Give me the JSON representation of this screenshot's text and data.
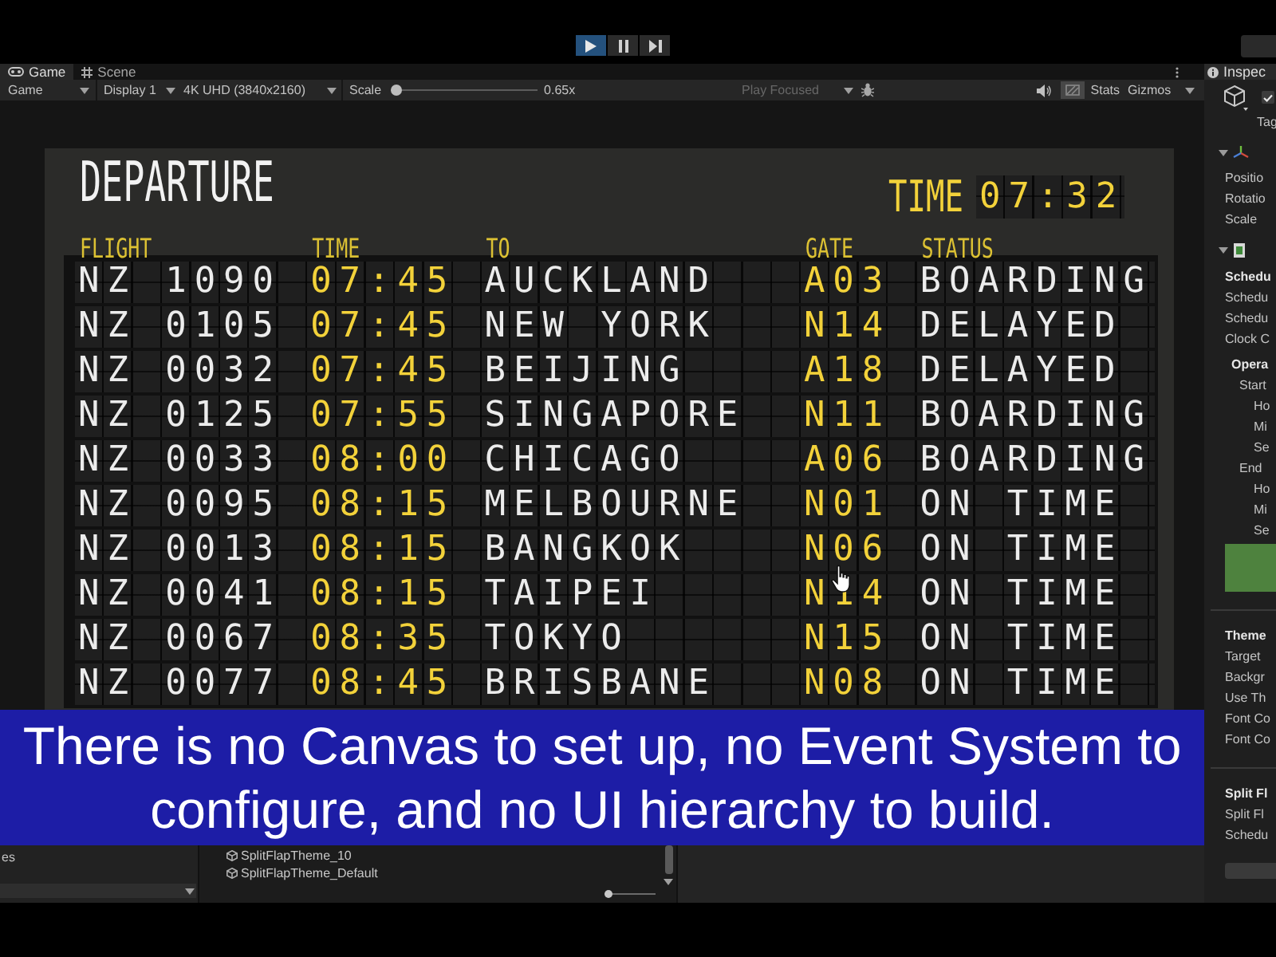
{
  "playback": [
    {
      "kind": "play",
      "on": true
    },
    {
      "kind": "pause",
      "on": false
    },
    {
      "kind": "step",
      "on": false
    }
  ],
  "tabs": [
    {
      "kind": "game",
      "label": "Game",
      "selected": true
    },
    {
      "kind": "scene",
      "label": "Scene",
      "selected": false
    }
  ],
  "game_toolbar": {
    "view": "Game",
    "display": "Display 1",
    "resolution": "4K UHD (3840x2160)",
    "scale_label": "Scale",
    "scale_slider": {
      "level": 0
    },
    "scale_reading": "0.65x",
    "play_mode": {
      "label": "Play Focused",
      "disabled": true
    },
    "stats": "Stats",
    "gizmos": "Gizmos"
  },
  "board": {
    "title": "DEPARTURE",
    "clock_label": "TIME",
    "clock": "07:32",
    "columns": [
      "FLIGHT",
      "TIME",
      "TO",
      "GATE",
      "STATUS"
    ],
    "rows": [
      {
        "flight": "NZ 1090",
        "time": "07:45",
        "to": "AUCKLAND",
        "gate": "A03",
        "status": "BOARDING"
      },
      {
        "flight": "NZ 0105",
        "time": "07:45",
        "to": "NEW YORK",
        "gate": "N14",
        "status": "DELAYED"
      },
      {
        "flight": "NZ 0032",
        "time": "07:45",
        "to": "BEIJING",
        "gate": "A18",
        "status": "DELAYED"
      },
      {
        "flight": "NZ 0125",
        "time": "07:55",
        "to": "SINGAPORE",
        "gate": "N11",
        "status": "BOARDING"
      },
      {
        "flight": "NZ 0033",
        "time": "08:00",
        "to": "CHICAGO",
        "gate": "A06",
        "status": "BOARDING"
      },
      {
        "flight": "NZ 0095",
        "time": "08:15",
        "to": "MELBOURNE",
        "gate": "N01",
        "status": "ON TIME"
      },
      {
        "flight": "NZ 0013",
        "time": "08:15",
        "to": "BANGKOK",
        "gate": "N06",
        "status": "ON TIME"
      },
      {
        "flight": "NZ 0041",
        "time": "08:15",
        "to": "TAIPEI",
        "gate": "N14",
        "status": "ON TIME"
      },
      {
        "flight": "NZ 0067",
        "time": "08:35",
        "to": "TOKYO",
        "gate": "N15",
        "status": "ON TIME"
      },
      {
        "flight": "NZ 0077",
        "time": "08:45",
        "to": "BRISBANE",
        "gate": "N08",
        "status": "ON TIME"
      }
    ]
  },
  "caption": "There is no Canvas to set up, no Event System to configure, and no UI hierarchy to build.",
  "project": {
    "folder_label": "es",
    "assets": [
      "SplitFlapTheme_10",
      "SplitFlapTheme_Default"
    ],
    "zoom_slider": {
      "level": 0
    }
  },
  "inspector": {
    "tab": "Inspec",
    "active": true,
    "tag_label": "Tag",
    "sections": [
      {
        "kind": "transform",
        "expanded": true,
        "fields": [
          {
            "kind": "field",
            "label": "Positio"
          },
          {
            "kind": "field",
            "label": "Rotatio"
          },
          {
            "kind": "field",
            "label": "Scale"
          }
        ]
      },
      {
        "kind": "script",
        "expanded": true,
        "fields": [
          {
            "kind": "header",
            "label": "Schedu"
          },
          {
            "kind": "field",
            "label": "Schedu"
          },
          {
            "kind": "field",
            "label": "Schedu"
          },
          {
            "kind": "field",
            "label": "Clock C"
          },
          {
            "kind": "group",
            "label": "Opera",
            "children": [
              {
                "kind": "field",
                "label": "Start",
                "children": [
                  {
                    "kind": "field",
                    "label": "Ho"
                  },
                  {
                    "kind": "field",
                    "label": "Mi"
                  },
                  {
                    "kind": "field",
                    "label": "Se"
                  }
                ]
              },
              {
                "kind": "field",
                "label": "End",
                "children": [
                  {
                    "kind": "field",
                    "label": "Ho"
                  },
                  {
                    "kind": "field",
                    "label": "Mi"
                  },
                  {
                    "kind": "field",
                    "label": "Se"
                  }
                ]
              }
            ]
          },
          {
            "kind": "button",
            "color": "#4e823e"
          },
          {
            "kind": "header",
            "label": "Theme"
          },
          {
            "kind": "field",
            "label": "Target"
          },
          {
            "kind": "field",
            "label": "Backgr"
          },
          {
            "kind": "field",
            "label": "Use Th"
          },
          {
            "kind": "field",
            "label": "Font Co"
          },
          {
            "kind": "field",
            "label": "Font Co"
          },
          {
            "kind": "header",
            "label": "Split Fl"
          },
          {
            "kind": "field",
            "label": "Split Fl"
          },
          {
            "kind": "field",
            "label": "Schedu"
          },
          {
            "kind": "footer_button",
            "color": "#3a3a3a"
          }
        ]
      }
    ]
  }
}
